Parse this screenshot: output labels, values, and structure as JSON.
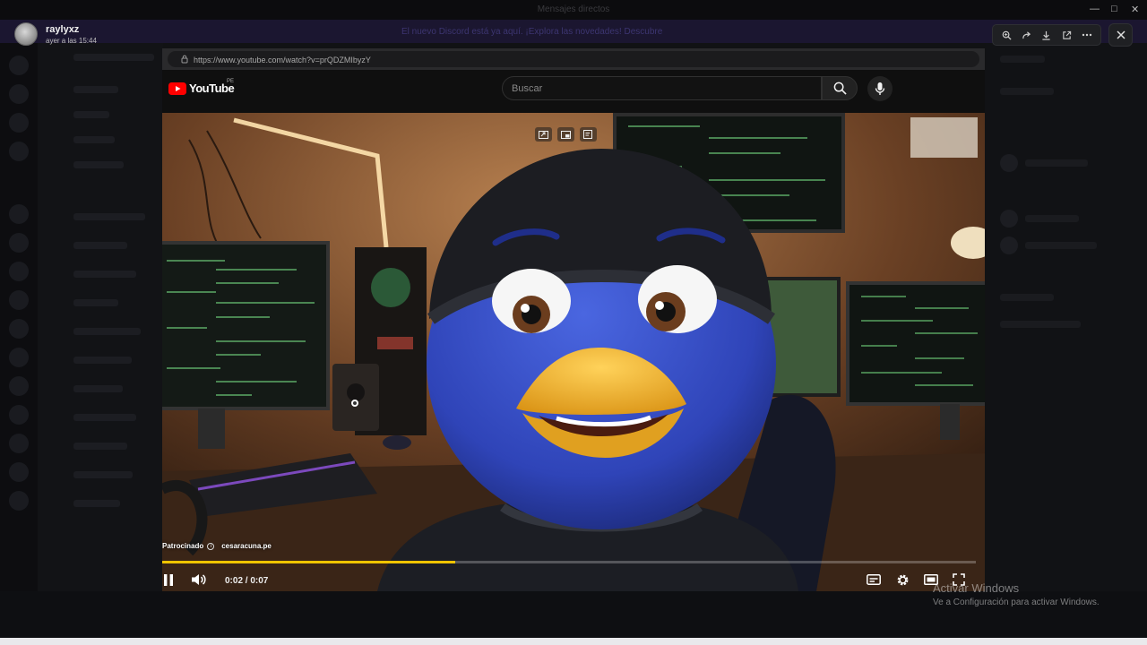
{
  "app": {
    "title": "Mensajes directos",
    "banner": "El nuevo Discord está ya aquí. ¡Explora las novedades!  Descubre"
  },
  "viewer": {
    "username": "raylyxz",
    "timestamp": "ayer a las 15:44",
    "toolbar": [
      "zoom-icon",
      "forward-icon",
      "download-icon",
      "open-external-icon",
      "more-icon"
    ],
    "close_icon": "close-icon"
  },
  "browser": {
    "url": "https://www.youtube.com/watch?v=prQDZMIbyzY"
  },
  "youtube": {
    "logo_text": "YouTube",
    "country_code": "PE",
    "search_placeholder": "Buscar"
  },
  "video": {
    "sponsor_label": "Patrocinado",
    "sponsor_info": "i",
    "sponsor_domain": "cesaracuna.pe",
    "time_display": "0:02 / 0:07",
    "progress_fraction": 0.36,
    "state": "playing"
  },
  "windows_notice": {
    "title": "Activar Windows",
    "subtitle": "Ve a Configuración para activar Windows."
  },
  "colors": {
    "yt_red": "#ff0000",
    "progress": "#f0c400",
    "banner": "#1b1630"
  }
}
